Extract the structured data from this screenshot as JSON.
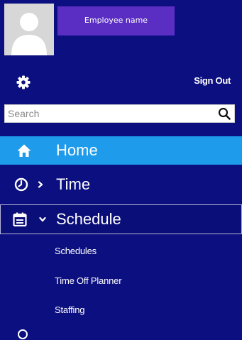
{
  "profile": {
    "employee_name": "Employee name"
  },
  "header": {
    "sign_out_label": "Sign Out",
    "settings_icon": "gear-icon"
  },
  "search": {
    "placeholder": "Search",
    "value": "",
    "icon": "search-icon"
  },
  "nav": {
    "home": {
      "label": "Home",
      "icon": "home-icon"
    },
    "time": {
      "label": "Time",
      "icon": "clock-icon",
      "chevron": "chevron-right-icon"
    },
    "schedule": {
      "label": "Schedule",
      "icon": "calendar-icon",
      "chevron": "chevron-down-icon",
      "expanded": true,
      "subitems": [
        {
          "label": "Schedules"
        },
        {
          "label": "Time Off Planner"
        },
        {
          "label": "Staffing"
        }
      ]
    }
  },
  "colors": {
    "sidebar_bg": "#0c0f7f",
    "active_item_bg": "#1e9bea",
    "employee_name_bg": "#5a2ec3",
    "text": "#ffffff"
  }
}
